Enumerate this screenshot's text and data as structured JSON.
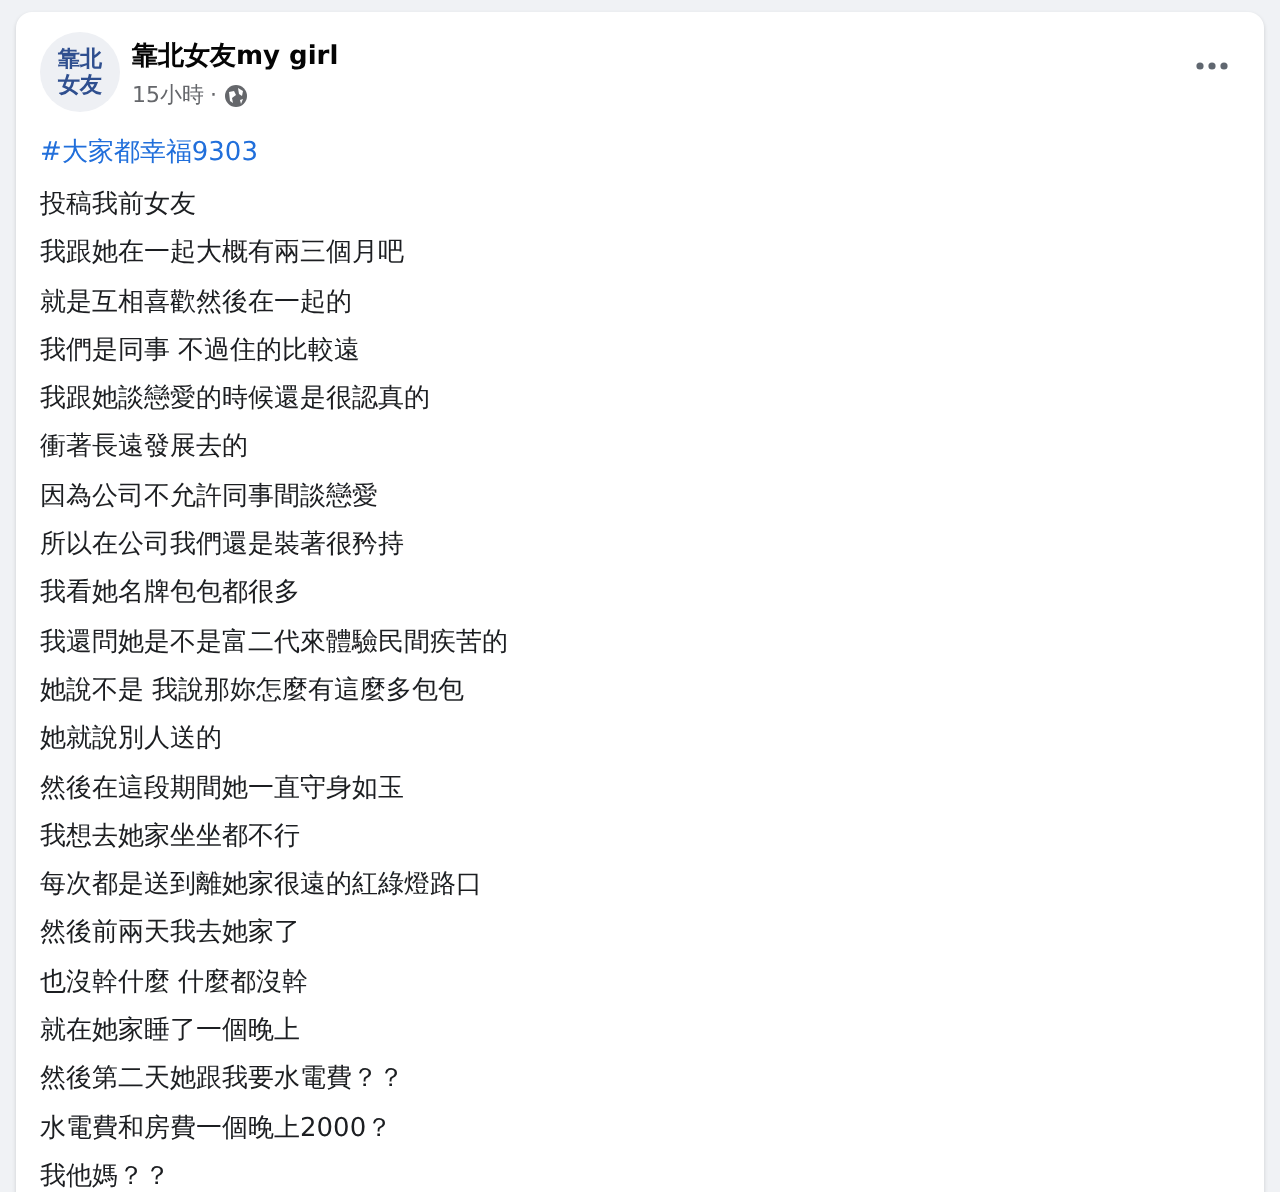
{
  "post": {
    "avatar": {
      "lines": [
        "靠北",
        "女友"
      ]
    },
    "author": "靠北女友my girl",
    "time": "15小時",
    "separator": "·",
    "hashtag": "#大家都幸福9303",
    "lines": [
      "投稿我前女友",
      "我跟她在一起大概有兩三個月吧",
      "就是互相喜歡然後在一起的",
      "我們是同事 不過住的比較遠",
      "我跟她談戀愛的時候還是很認真的",
      "衝著長遠發展去的",
      "因為公司不允許同事間談戀愛",
      "所以在公司我們還是裝著很矜持",
      "我看她名牌包包都很多",
      "我還問她是不是富二代來體驗民間疾苦的",
      "她說不是 我說那妳怎麼有這麼多包包",
      "她就說別人送的",
      "然後在這段期間她一直守身如玉",
      "我想去她家坐坐都不行",
      "每次都是送到離她家很遠的紅綠燈路口",
      "然後前兩天我去她家了",
      "也沒幹什麼 什麼都沒幹",
      "就在她家睡了一個晚上",
      "然後第二天她跟我要水電費？？",
      "水電費和房費一個晚上2000？",
      "我他媽？？"
    ]
  }
}
